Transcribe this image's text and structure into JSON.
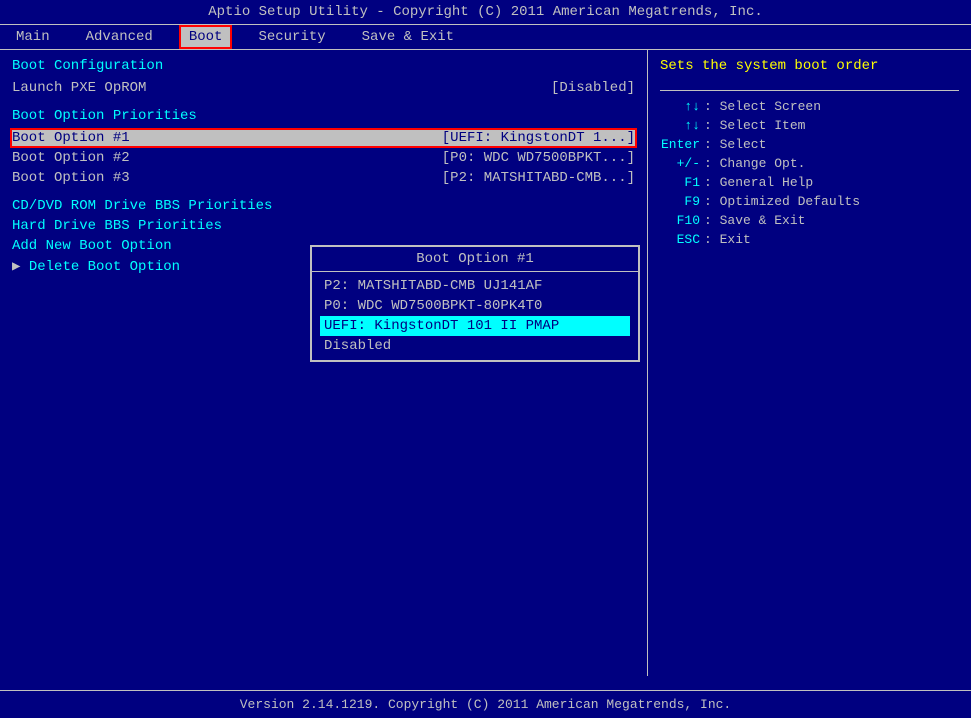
{
  "title_bar": {
    "text": "Aptio Setup Utility - Copyright (C) 2011 American Megatrends, Inc."
  },
  "menu_bar": {
    "items": [
      {
        "id": "main",
        "label": "Main",
        "active": false
      },
      {
        "id": "advanced",
        "label": "Advanced",
        "active": false
      },
      {
        "id": "boot",
        "label": "Boot",
        "active": true
      },
      {
        "id": "security",
        "label": "Security",
        "active": false
      },
      {
        "id": "save_exit",
        "label": "Save & Exit",
        "active": false
      }
    ]
  },
  "left_panel": {
    "boot_config_title": "Boot Configuration",
    "launch_pxe_label": "Launch PXE OpROM",
    "launch_pxe_value": "[Disabled]",
    "priorities_title": "Boot Option Priorities",
    "boot_options": [
      {
        "label": "Boot Option #1",
        "value": "[UEFI: KingstonDT 1...]",
        "selected": true
      },
      {
        "label": "Boot Option #2",
        "value": "[P0: WDC WD7500BPKT...]"
      },
      {
        "label": "Boot Option #3",
        "value": "[P2: MATSHITABD-CMB...]"
      }
    ],
    "menu_items": [
      {
        "label": "CD/DVD ROM Drive BBS Priorities",
        "arrow": false
      },
      {
        "label": "Hard Drive BBS Priorities",
        "arrow": false
      },
      {
        "label": "Add New Boot Option",
        "arrow": false
      },
      {
        "label": "Delete Boot Option",
        "arrow": true
      }
    ]
  },
  "popup": {
    "title": "Boot Option #1",
    "items": [
      {
        "label": "P2: MATSHITABD-CMB UJ141AF",
        "highlighted": false
      },
      {
        "label": "P0: WDC WD7500BPKT-80PK4T0",
        "highlighted": false
      },
      {
        "label": "UEFI: KingstonDT 101 II PMAP",
        "highlighted": true
      },
      {
        "label": "Disabled",
        "highlighted": false
      }
    ]
  },
  "right_panel": {
    "help_text": "Sets the system boot order",
    "keys": [
      {
        "key": "↑↓",
        "desc": ": Select Screen"
      },
      {
        "key": "↑↓",
        "desc": ": Select Item"
      },
      {
        "key": "Enter",
        "desc": ": Select"
      },
      {
        "key": "+/-",
        "desc": ": Change Opt."
      },
      {
        "key": "F1",
        "desc": ": General Help"
      },
      {
        "key": "F9",
        "desc": ": Optimized Defaults"
      },
      {
        "key": "F10",
        "desc": ": Save & Exit"
      },
      {
        "key": "ESC",
        "desc": ": Exit"
      }
    ]
  },
  "status_bar": {
    "text": "Version 2.14.1219. Copyright (C) 2011 American Megatrends, Inc."
  }
}
